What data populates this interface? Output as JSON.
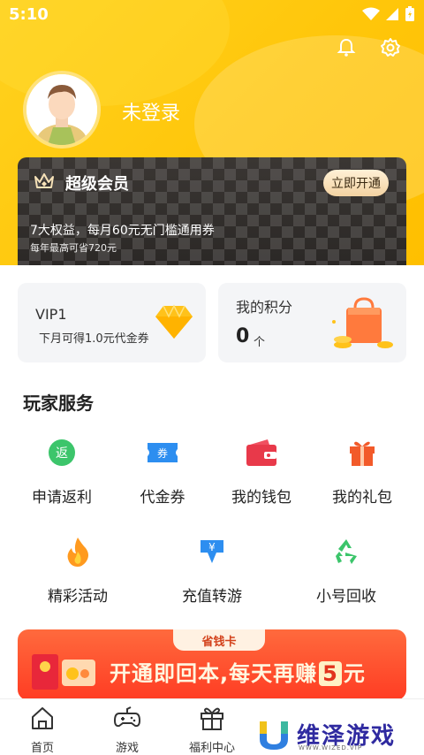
{
  "status_bar": {
    "time": "5:10"
  },
  "profile": {
    "login_status": "未登录"
  },
  "vip": {
    "title": "超级会员",
    "open_button": "立即开通",
    "benefit_line": "7大权益，每月60元无门槛通用券",
    "saving_line": "每年最高可省720元"
  },
  "vip_card": {
    "level": "VIP1",
    "desc": "下月可得1.0元代金券"
  },
  "points_card": {
    "title": "我的积分",
    "value": "0",
    "unit": "个"
  },
  "services": {
    "title": "玩家服务",
    "items": [
      {
        "label": "申请返利",
        "icon": "rebate-icon"
      },
      {
        "label": "代金券",
        "icon": "coupon-icon"
      },
      {
        "label": "我的钱包",
        "icon": "wallet-icon"
      },
      {
        "label": "我的礼包",
        "icon": "gift-icon"
      },
      {
        "label": "精彩活动",
        "icon": "fire-icon"
      },
      {
        "label": "充值转游",
        "icon": "recharge-icon"
      },
      {
        "label": "小号回收",
        "icon": "recycle-icon"
      }
    ]
  },
  "banner": {
    "tag": "省钱卡",
    "text_before": "开通即回本,每天再赚",
    "number": "5",
    "text_after": "元"
  },
  "tabbar": {
    "items": [
      {
        "label": "首页",
        "icon": "home-icon"
      },
      {
        "label": "游戏",
        "icon": "gamepad-icon"
      },
      {
        "label": "福利中心",
        "icon": "gift-box-icon"
      }
    ]
  },
  "watermark": {
    "text": "维泽游戏",
    "sub": "WWW.WIZED.VIP"
  },
  "colors": {
    "header": "#ffc60a",
    "accent_red": "#ff3c23",
    "vip_dark": "#2b2826"
  }
}
